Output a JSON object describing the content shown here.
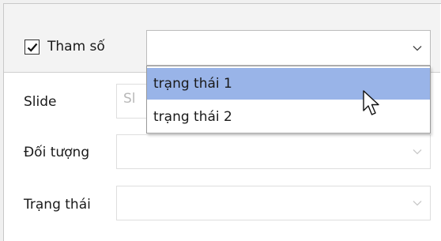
{
  "param_toggle": {
    "label": "Tham số",
    "checked": true
  },
  "param_select": {
    "value": ""
  },
  "dropdown": {
    "options": [
      "trạng thái 1",
      "trạng thái 2"
    ],
    "highlighted_index": 0
  },
  "fields": {
    "slide": {
      "label": "Slide",
      "placeholder": "Sl"
    },
    "object": {
      "label": "Đối tượng"
    },
    "state": {
      "label": "Trạng thái"
    }
  },
  "colors": {
    "highlight": "#99b4e8",
    "header_bg": "#f3f3f3",
    "border": "#bcbcbc"
  },
  "icons": {
    "checkbox": "check-icon",
    "combo": "chevron-down-icon",
    "pointer": "mouse-pointer-icon"
  }
}
